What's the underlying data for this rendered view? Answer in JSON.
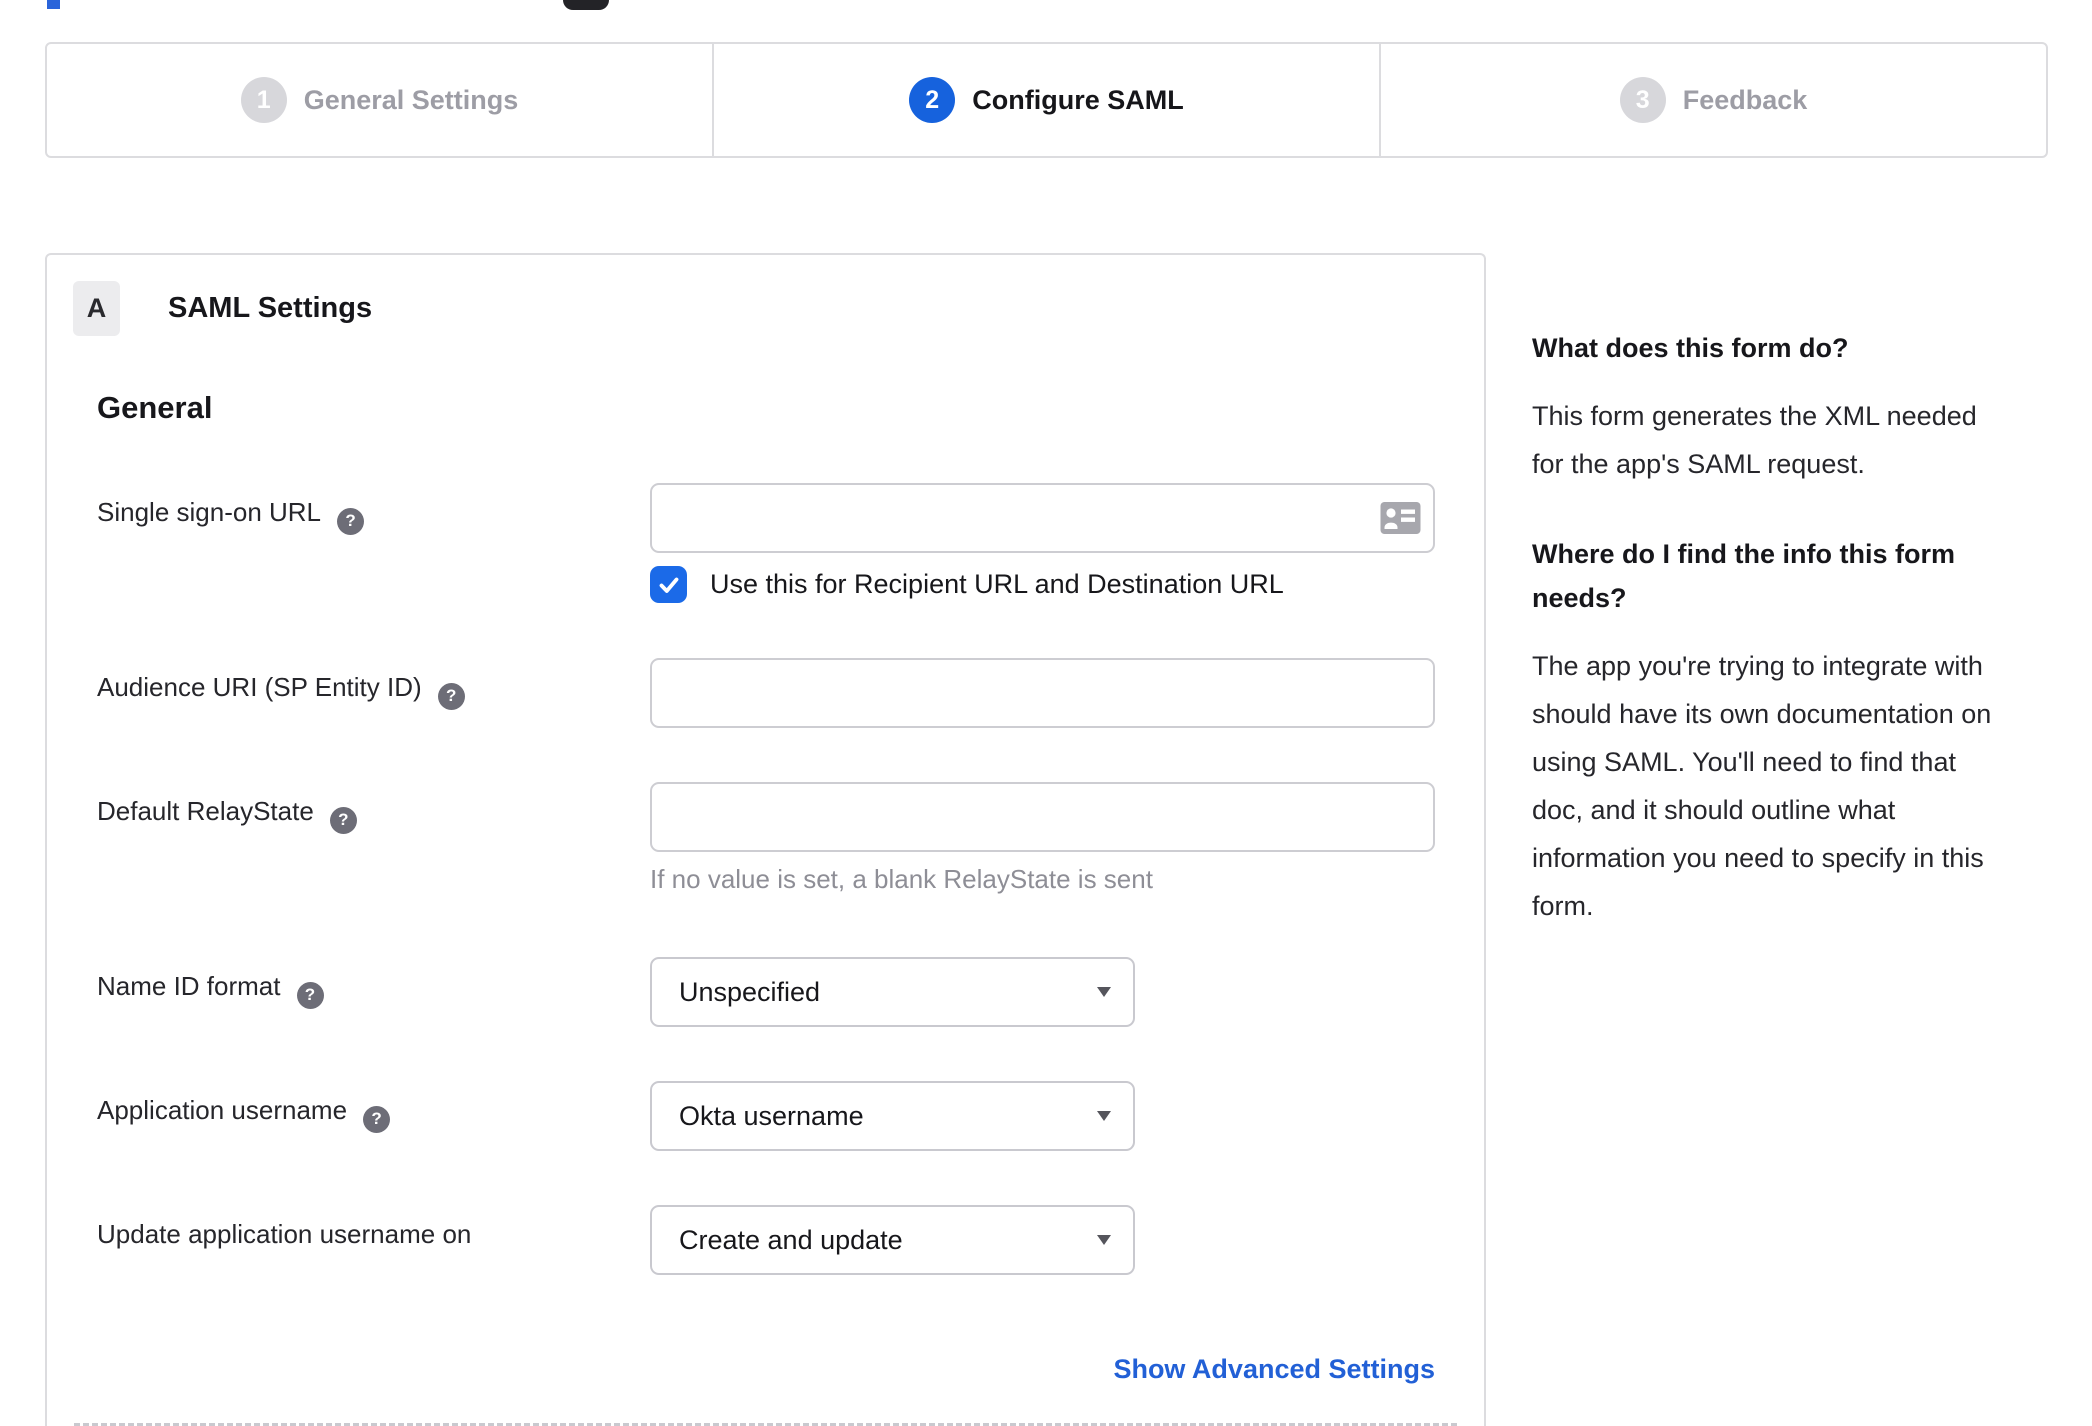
{
  "stepper": {
    "steps": [
      {
        "number": "1",
        "label": "General Settings"
      },
      {
        "number": "2",
        "label": "Configure SAML"
      },
      {
        "number": "3",
        "label": "Feedback"
      }
    ]
  },
  "panel": {
    "badge": "A",
    "title": "SAML Settings",
    "section": "General"
  },
  "form": {
    "sso": {
      "label": "Single sign-on URL",
      "value": "",
      "checkbox_label": "Use this for Recipient URL and Destination URL",
      "checkbox_checked": true
    },
    "audience": {
      "label": "Audience URI (SP Entity ID)",
      "value": ""
    },
    "relay": {
      "label": "Default RelayState",
      "value": "",
      "hint": "If no value is set, a blank RelayState is sent"
    },
    "name_id": {
      "label": "Name ID format",
      "value": "Unspecified"
    },
    "app_username": {
      "label": "Application username",
      "value": "Okta username"
    },
    "update_on": {
      "label": "Update application username on",
      "value": "Create and update"
    },
    "advanced_link": "Show Advanced Settings"
  },
  "icons": {
    "help": "?"
  },
  "sidebar": {
    "q1": "What does this form do?",
    "a1": "This form generates the XML needed\nfor the app's SAML request.",
    "q2": "Where do I find the info this form\nneeds?",
    "a2": "The app you're trying to integrate with\nshould have its own documentation on\nusing SAML. You'll need to find that\ndoc, and it should outline what\ninformation you need to specify in this\nform."
  },
  "colors": {
    "active_step_blue": "#1662dd",
    "checkbox_blue": "#1b6ae8",
    "link_blue": "#2260d6"
  }
}
